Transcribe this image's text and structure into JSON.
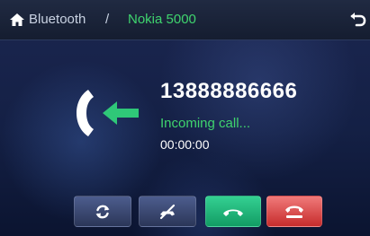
{
  "header": {
    "breadcrumb_parent": "Bluetooth",
    "breadcrumb_separator": "/",
    "device_name": "Nokia 5000",
    "home_icon": "home-icon",
    "back_icon": "back-icon"
  },
  "call": {
    "number": "13888886666",
    "status": "Incoming call...",
    "duration": "00:00:00",
    "icon": "incoming-call-icon"
  },
  "actions": [
    {
      "name": "switch-audio",
      "icon": "refresh-icon"
    },
    {
      "name": "mute",
      "icon": "mute-icon"
    },
    {
      "name": "answer",
      "icon": "handset-icon"
    },
    {
      "name": "reject",
      "icon": "hang-up-icon"
    }
  ],
  "colors": {
    "accent_green": "#3fd46e",
    "answer_green": "#21b87a",
    "reject_red": "#dc4242",
    "background": "#142045"
  }
}
